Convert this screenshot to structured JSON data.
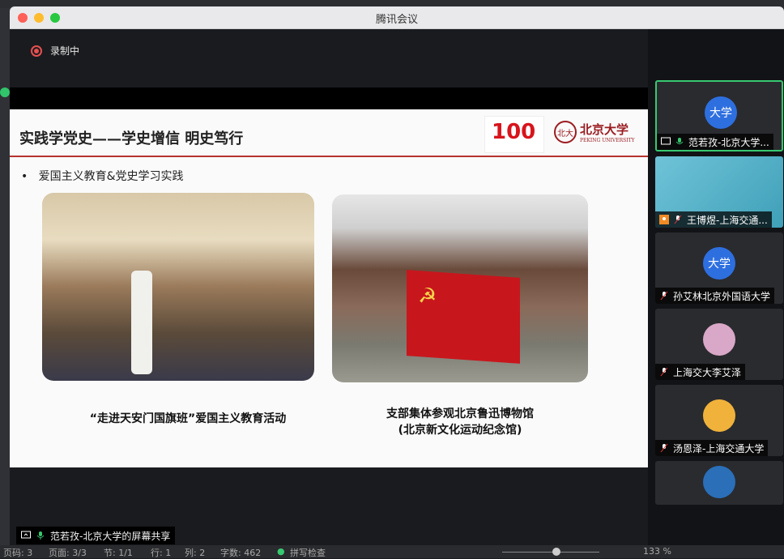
{
  "window": {
    "title": "腾讯会议"
  },
  "recording": {
    "label": "录制中"
  },
  "slide": {
    "title": "实践学党史——学史增信 明史笃行",
    "logo_text": "100",
    "pku_cn": "北京大学",
    "pku_en": "PEKING UNIVERSITY",
    "bullet": "爱国主义教育&党史学习实践",
    "caption1": "“走进天安门国旗班”爱国主义教育活动",
    "caption2_line1": "支部集体参观北京鲁迅博物馆",
    "caption2_line2": "(北京新文化运动纪念馆)"
  },
  "share_label": "范若孜-北京大学的屏幕共享",
  "participants": [
    {
      "name": "范若孜-北京大学...",
      "avatar": "大学"
    },
    {
      "name": "王博煜-上海交通..."
    },
    {
      "name": "孙艾林北京外国语大学",
      "avatar": "大学"
    },
    {
      "name": "上海交大李艾泽"
    },
    {
      "name": "汤恩泽-上海交通大学"
    }
  ],
  "statusbar": {
    "pages": "页码: 3",
    "page": "页面: 3/3",
    "section": "节: 1/1",
    "row": "行: 1",
    "col": "列: 2",
    "words": "字数: 462",
    "spell": "拼写检查",
    "zoom": "133 %"
  },
  "colors": {
    "accent_red": "#b5332e",
    "active_green": "#37c871",
    "avatar_blue": "#2e6fe0"
  }
}
